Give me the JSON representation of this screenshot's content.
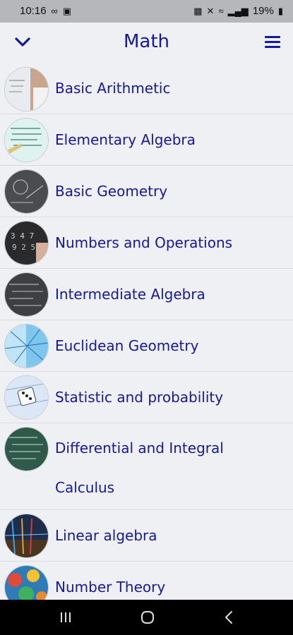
{
  "status": {
    "time": "10:16",
    "battery": "19%"
  },
  "header": {
    "title": "Math",
    "back_icon": "chevron-down-icon",
    "menu_icon": "hamburger-menu-icon"
  },
  "topics": [
    {
      "label": "Basic Arithmetic",
      "image": "whiteboard-photo"
    },
    {
      "label": "Elementary Algebra",
      "image": "algebra-notes-photo"
    },
    {
      "label": "Basic Geometry",
      "image": "chalkboard-geometry-photo"
    },
    {
      "label": "Numbers and Operations",
      "image": "chalk-numbers-photo"
    },
    {
      "label": "Intermediate Algebra",
      "image": "chalkboard-equations-photo"
    },
    {
      "label": "Euclidean Geometry",
      "image": "geometric-lines-photo"
    },
    {
      "label": "Statistic and probability",
      "image": "dice-photo"
    },
    {
      "label": "Differential and Integral",
      "label2": "Calculus",
      "image": "green-chalkboard-photo"
    },
    {
      "label": "Linear algebra",
      "image": "colorful-lines-photo"
    },
    {
      "label": "Number Theory",
      "image": "colorful-numbers-photo"
    }
  ],
  "colors": {
    "accent": "#17189a",
    "background": "#eef0f4",
    "divider": "#d9dce1"
  }
}
